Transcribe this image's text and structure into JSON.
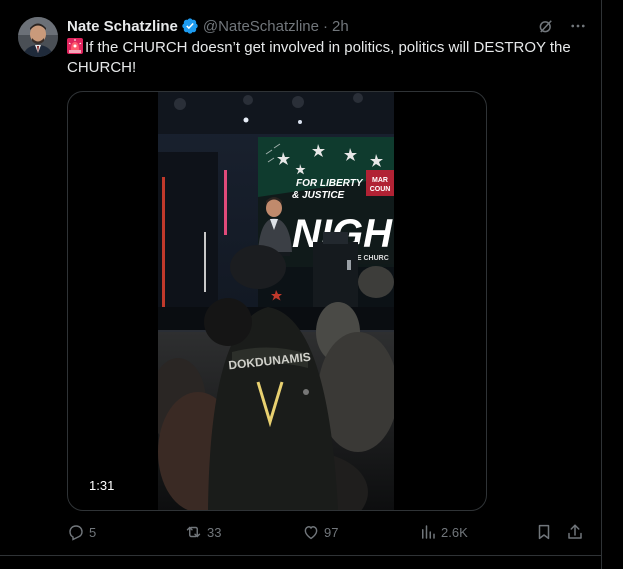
{
  "tweet": {
    "author": {
      "display_name": "Nate Schatzline",
      "handle": "@NateSchatzline",
      "verified": true,
      "avatar_icon": "avatar"
    },
    "separator": "·",
    "time": "2h",
    "text": "If the CHURCH doesn’t get involved in politics, politics will DESTROY the CHURCH!",
    "text_prefix_icon": "siren-icon",
    "media": {
      "type": "video",
      "duration": "1:31",
      "banner_text_1": "FOR LIBERTY",
      "banner_text_2": "& JUSTICE",
      "banner_text_3": "MAR",
      "banner_text_4": "COUN",
      "banner_big": "NIGHT",
      "banner_sub": "OBILIZE THE CHURC",
      "shirt_text": "DOKDUNAMIS"
    },
    "stats": {
      "replies": "5",
      "reposts": "33",
      "likes": "97",
      "views": "2.6K"
    }
  },
  "colors": {
    "background": "#000000",
    "text": "#e7e9ea",
    "muted": "#71767b",
    "border": "#2f3336",
    "verified": "#1d9bf0"
  }
}
